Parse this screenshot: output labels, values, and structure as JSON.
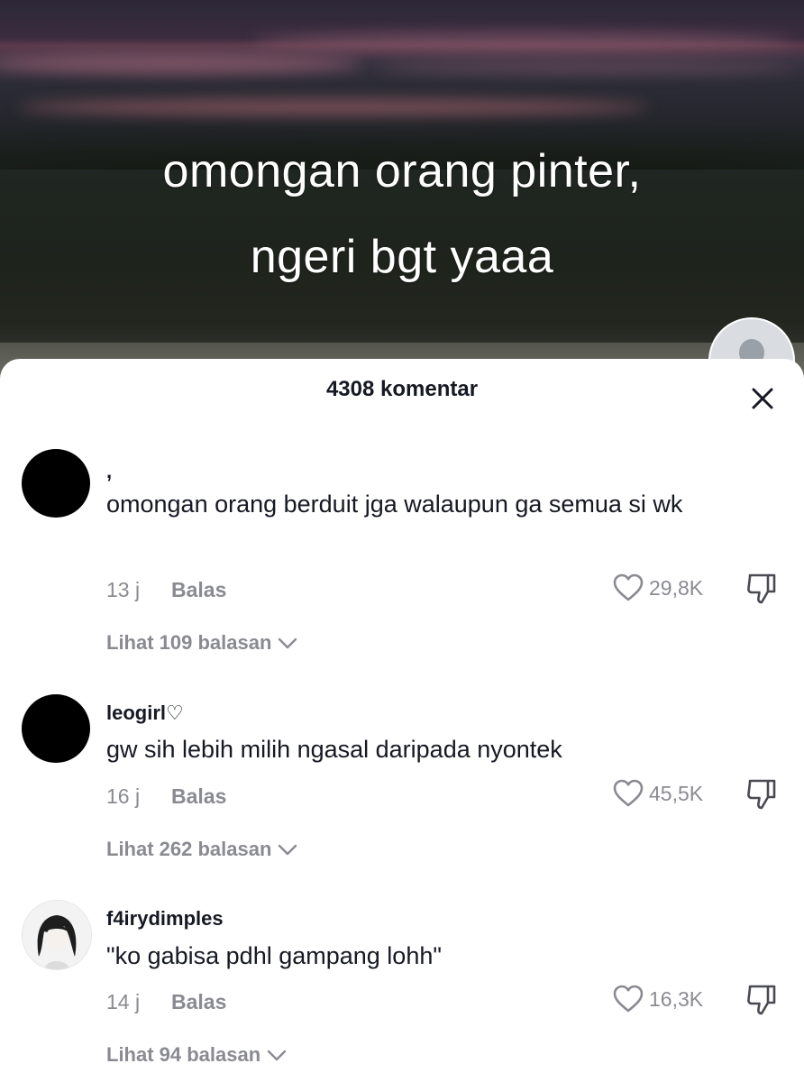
{
  "video": {
    "caption_line1": "omongan orang pinter,",
    "caption_line2": "ngeri bgt yaaa"
  },
  "panel": {
    "title": "4308 komentar"
  },
  "comments": [
    {
      "username": ",",
      "text": "omongan orang berduit jga walaupun ga semua si wk",
      "time": "13 j",
      "reply_label": "Balas",
      "likes": "29,8K",
      "view_replies": "Lihat 109 balasan"
    },
    {
      "username": "leogirl♡",
      "text": "gw sih lebih milih ngasal daripada nyontek",
      "time": "16 j",
      "reply_label": "Balas",
      "likes": "45,5K",
      "view_replies": "Lihat 262 balasan"
    },
    {
      "username": "f4irydimples",
      "text": "\"ko gabisa pdhl gampang lohh\"",
      "time": "14 j",
      "reply_label": "Balas",
      "likes": "16,3K",
      "view_replies": "Lihat 94 balasan"
    }
  ],
  "icons": {
    "close": "close-icon",
    "like": "heart-outline-icon",
    "dislike": "thumbs-down-icon",
    "expand": "chevron-down-icon"
  },
  "colors": {
    "primary_text": "#161823",
    "secondary_text": "#8a8b91",
    "background": "#ffffff"
  }
}
